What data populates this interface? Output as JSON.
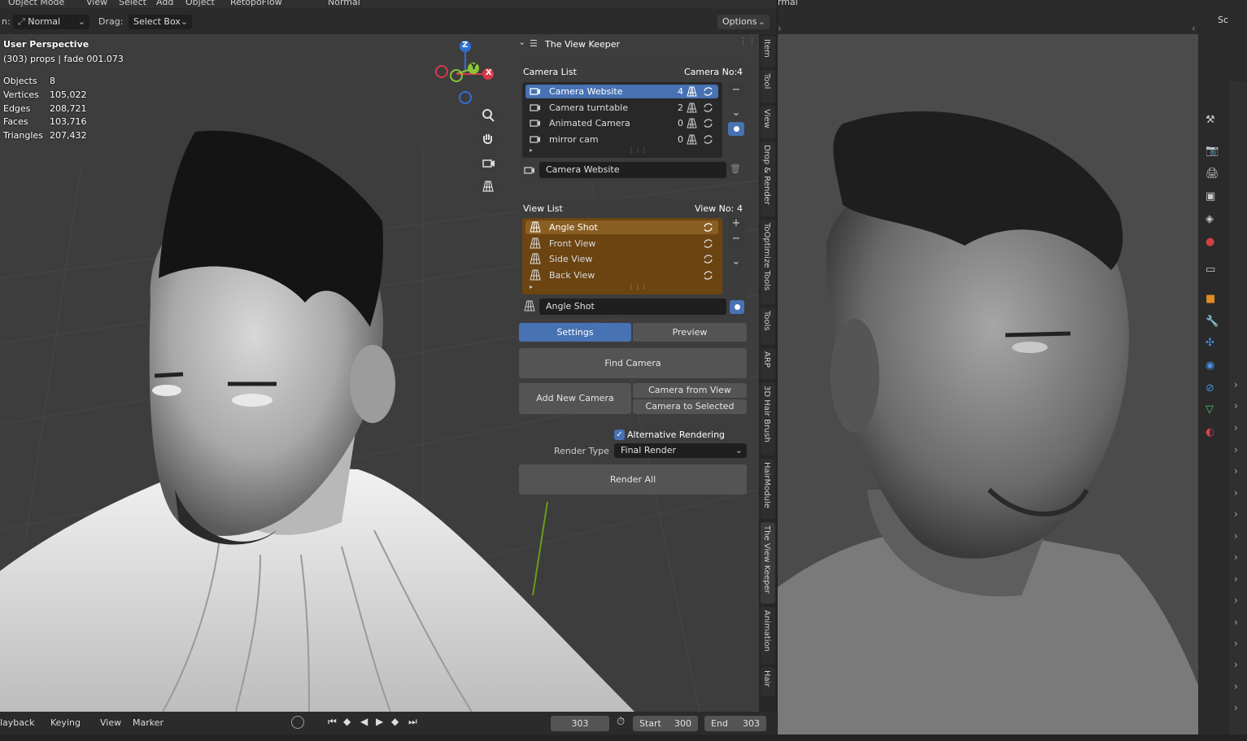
{
  "header": {
    "mode_menu": "Object Mode",
    "menu_view": "View",
    "menu_select": "Select",
    "menu_add": "Add",
    "menu_object": "Object",
    "menu_retopoflow": "RetopoFlow",
    "orientation": "Normal",
    "right_orientation": "rmal"
  },
  "toolbar": {
    "prefix": "n:",
    "transform_label": "Normal",
    "drag_label": "Drag:",
    "drag_value": "Select Box",
    "options_label": "Options"
  },
  "viewport": {
    "perspective": "User Perspective",
    "object_info": "(303) props | fade 001.073",
    "stats": [
      {
        "label": "Objects",
        "value": "8"
      },
      {
        "label": "Vertices",
        "value": "105,022"
      },
      {
        "label": "Edges",
        "value": "208,721"
      },
      {
        "label": "Faces",
        "value": "103,716"
      },
      {
        "label": "Triangles",
        "value": "207,432"
      }
    ],
    "gizmo_z": "Z",
    "gizmo_y": "Y",
    "gizmo_x": "X"
  },
  "panel": {
    "title": "The View Keeper",
    "camera_list_label": "Camera List",
    "camera_no_label": "Camera No:",
    "camera_no": "4",
    "cameras": [
      {
        "name": "Camera Website",
        "count": "4"
      },
      {
        "name": "Camera turntable",
        "count": "2"
      },
      {
        "name": "Animated Camera",
        "count": "0"
      },
      {
        "name": "mirror cam",
        "count": "0"
      }
    ],
    "camera_field": "Camera Website",
    "view_list_label": "View List",
    "view_no_label": "View No:",
    "view_no": "4",
    "views": [
      {
        "name": "Angle Shot"
      },
      {
        "name": "Front View"
      },
      {
        "name": "Side View"
      },
      {
        "name": "Back View"
      }
    ],
    "view_field": "Angle Shot",
    "tab_settings": "Settings",
    "tab_preview": "Preview",
    "find_camera": "Find Camera",
    "add_new_camera": "Add New Camera",
    "camera_from_view": "Camera from View",
    "camera_to_selected": "Camera to Selected",
    "alt_rendering_label": "Alternative Rendering",
    "alt_rendering_checked": true,
    "render_type_label": "Render Type",
    "render_type_value": "Final Render",
    "render_all": "Render All"
  },
  "vertical_tabs": [
    "Item",
    "Tool",
    "View",
    "Drop & Render",
    "ToOptimize Tools",
    "Tools",
    "ARP",
    "3D Hair Brush",
    "HairModule",
    "The View Keeper",
    "Animation",
    "Hair"
  ],
  "timeline": {
    "playback": "layback",
    "keying": "Keying",
    "view": "View",
    "marker": "Marker",
    "current_frame": "303",
    "start_label": "Start",
    "start": "300",
    "end_label": "End",
    "end": "303"
  },
  "outliner": {
    "scene_label": "Sc"
  },
  "colors": {
    "accent": "#4772b3",
    "view_list_bg": "#6b4412",
    "view_selected": "#8a5e22"
  }
}
